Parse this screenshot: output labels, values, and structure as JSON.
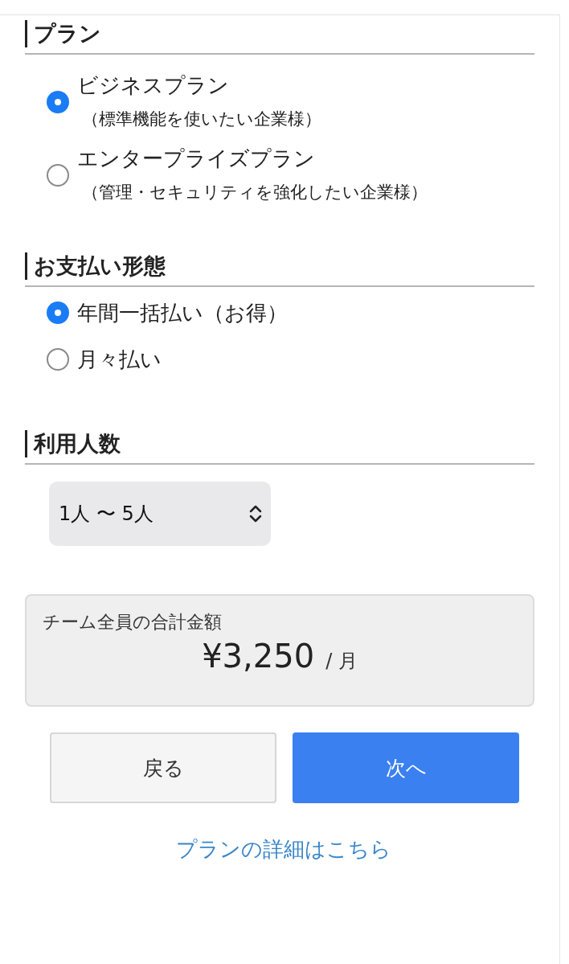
{
  "sections": [
    {
      "kind": "radio",
      "title": "プラン",
      "options": [
        {
          "label": "ビジネスプラン",
          "note": "（標準機能を使いたい企業様）",
          "selected": true
        },
        {
          "label": "エンタープライズプラン",
          "note": "（管理・セキュリティを強化したい企業様）",
          "selected": false
        }
      ]
    },
    {
      "kind": "radio",
      "title": "お支払い形態",
      "options": [
        {
          "label": "年間一括払い（お得）",
          "selected": true
        },
        {
          "label": "月々払い",
          "selected": false
        }
      ]
    },
    {
      "kind": "select",
      "title": "利用人数",
      "value": "1人 〜 5人"
    }
  ],
  "total": {
    "label": "チーム全員の合計金額",
    "amount": "¥3,250",
    "unit": "/ 月"
  },
  "buttons": [
    {
      "label": "戻る",
      "kind": "secondary"
    },
    {
      "label": "次へ",
      "kind": "primary"
    }
  ],
  "link": "プランの詳細はこちら"
}
